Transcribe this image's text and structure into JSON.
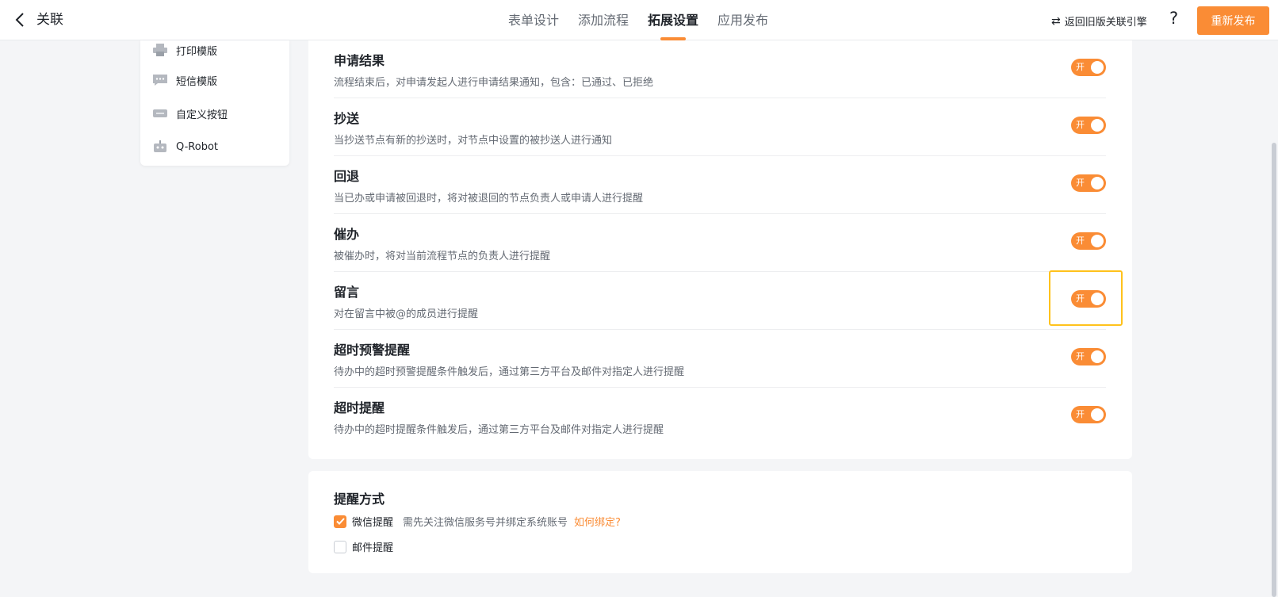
{
  "header": {
    "back_title": "关联",
    "tabs": [
      {
        "label": "表单设计",
        "active": false
      },
      {
        "label": "添加流程",
        "active": false
      },
      {
        "label": "拓展设置",
        "active": true
      },
      {
        "label": "应用发布",
        "active": false
      }
    ],
    "legacy_link": "返回旧版关联引擎",
    "help": "?",
    "publish_label": "重新发布"
  },
  "sidebar": {
    "items": [
      {
        "label": "打印模版",
        "icon": "printer-icon"
      },
      {
        "label": "短信模版",
        "icon": "message-icon"
      },
      {
        "label": "自定义按钮",
        "icon": "custom-button-icon"
      },
      {
        "label": "Q-Robot",
        "icon": "robot-icon"
      }
    ]
  },
  "notifications": [
    {
      "title": "申请结果",
      "desc": "流程结束后，对申请发起人进行申请结果通知，包含：已通过、已拒绝",
      "switch_text": "开",
      "on": true
    },
    {
      "title": "抄送",
      "desc": "当抄送节点有新的抄送时，对节点中设置的被抄送人进行通知",
      "switch_text": "开",
      "on": true
    },
    {
      "title": "回退",
      "desc": "当已办或申请被回退时，将对被退回的节点负责人或申请人进行提醒",
      "switch_text": "开",
      "on": true
    },
    {
      "title": "催办",
      "desc": "被催办时，将对当前流程节点的负责人进行提醒",
      "switch_text": "开",
      "on": true
    },
    {
      "title": "留言",
      "desc": "对在留言中被@的成员进行提醒",
      "switch_text": "开",
      "on": true
    },
    {
      "title": "超时预警提醒",
      "desc": "待办中的超时预警提醒条件触发后，通过第三方平台及邮件对指定人进行提醒",
      "switch_text": "开",
      "on": true
    },
    {
      "title": "超时提醒",
      "desc": "待办中的超时提醒条件触发后，通过第三方平台及邮件对指定人进行提醒",
      "switch_text": "开",
      "on": true
    }
  ],
  "remind": {
    "title": "提醒方式",
    "wechat": {
      "label": "微信提醒",
      "checked": true,
      "hint": "需先关注微信服务号并绑定系统账号",
      "link": "如何绑定?"
    },
    "email": {
      "label": "邮件提醒",
      "checked": false
    }
  },
  "colors": {
    "accent": "#fa8c35",
    "highlight": "#ffc21c"
  }
}
